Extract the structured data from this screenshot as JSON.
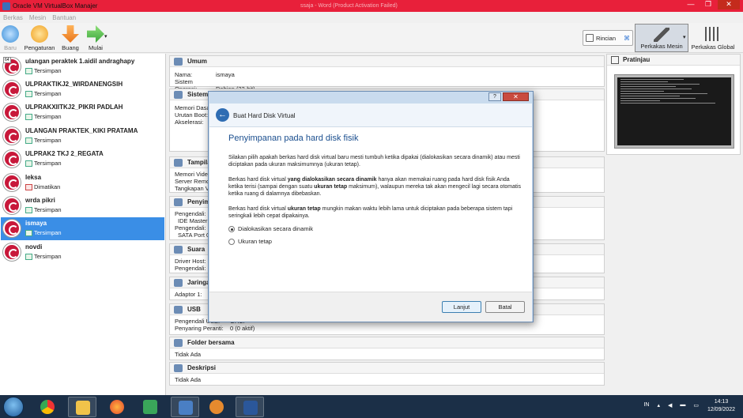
{
  "window": {
    "title": "Oracle VM VirtualBox Manajer",
    "bg_title": "ssaja - Word (Product Activation Failed)"
  },
  "menu": [
    "Berkas",
    "Mesin",
    "Bantuan"
  ],
  "toolbar": {
    "baru": "Baru",
    "pengaturan": "Pengaturan",
    "buang": "Buang",
    "mulai": "Mulai",
    "rincian": "Rincian",
    "perkakas_mesin": "Perkakas Mesin",
    "perkakas_global": "Perkakas Global"
  },
  "vms": [
    {
      "name": "ulangan peraktek 1.aidil andraghapy",
      "state": "Tersimpan",
      "badge": "64"
    },
    {
      "name": "ULPRAKTIKJ2_WIRDANENGSIH",
      "state": "Tersimpan"
    },
    {
      "name": "ULPRAKXIITKJ2_PIKRI PADLAH",
      "state": "Tersimpan"
    },
    {
      "name": "ULANGAN PRAKTEK_KIKI PRATAMA",
      "state": "Tersimpan"
    },
    {
      "name": "ULPRAK2 TKJ 2_REGATA",
      "state": "Tersimpan"
    },
    {
      "name": "leksa",
      "state": "Dimatikan"
    },
    {
      "name": "wrda pikri",
      "state": "Tersimpan"
    },
    {
      "name": "ismaya",
      "state": "Tersimpan",
      "selected": true
    },
    {
      "name": "novdi",
      "state": "Tersimpan"
    }
  ],
  "details": {
    "umum": {
      "title": "Umum",
      "nama_label": "Nama:",
      "nama": "ismaya",
      "os_label": "Sistem Operasi:",
      "os": "Debian (32-bit)"
    },
    "sistem": {
      "title": "Sistem",
      "r1": "Memori Dasar",
      "r2": "Urutan Boot:",
      "r3": "Akselerasi:"
    },
    "tampilan": {
      "title": "Tampilan",
      "r1": "Memori Video",
      "r2": "Server Remot",
      "r3": "Tangkapan V"
    },
    "penyimpanan": {
      "title": "Penyimpanan",
      "r1": "Pengendali: I",
      "r2": "IDE Master",
      "r3": "Pengendali: S",
      "r4": "SATA Port 0"
    },
    "suara": {
      "title": "Suara",
      "r1": "Driver Host:",
      "r2": "Pengendali:"
    },
    "jaringan": {
      "title": "Jaringan",
      "r1": "Adaptor 1:"
    },
    "usb": {
      "title": "USB",
      "r1": "Pengendali USB:",
      "r1v": "OHCI",
      "r2": "Penyaring Peranti:",
      "r2v": "0 (0 aktif)"
    },
    "folder": {
      "title": "Folder bersama",
      "r1": "Tidak Ada"
    },
    "deskripsi": {
      "title": "Deskripsi",
      "r1": "Tidak Ada"
    }
  },
  "preview": {
    "title": "Pratinjau"
  },
  "dialog": {
    "help": "?",
    "close": "✕",
    "title": "Buat Hard Disk Virtual",
    "heading": "Penyimpanan pada hard disk fisik",
    "p1": "Silakan pilih apakah berkas hard disk virtual baru mesti tumbuh ketika dipakai (dialokasikan secara dinamik) atau mesti diciptakan pada ukuran maksimumnya (ukuran tetap).",
    "p2a": "Berkas hard disk virtual ",
    "p2b": "yang dialokasikan secara dinamik",
    "p2c": " hanya akan memakai ruang pada hard disk fisik Anda ketika terisi (sampai dengan suatu ",
    "p2d": "ukuran tetap",
    "p2e": " maksimum), walaupun mereka tak akan mengecil lagi secara otomatis ketika ruang di dalamnya dibebaskan.",
    "p3a": "Berkas hard disk virtual ",
    "p3b": "ukuran tetap",
    "p3c": " mungkin makan waktu lebih lama untuk diciptakan pada beberapa sistem tapi seringkali lebih cepat dipakainya.",
    "opt1": "Dialokasikan secara dinamik",
    "opt2": "Ukuran tetap",
    "next": "Lanjut",
    "cancel": "Batal"
  },
  "taskbar": {
    "lang": "IN",
    "time": "14:13",
    "date": "12/09/2022"
  }
}
